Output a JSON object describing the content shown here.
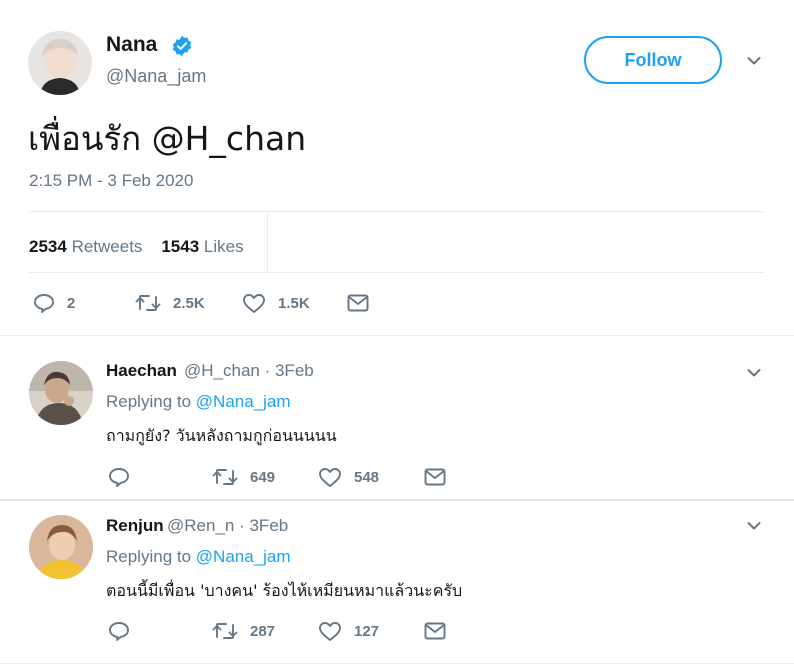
{
  "tweet": {
    "author_name": "Nana",
    "author_handle": "@Nana_jam",
    "follow_label": "Follow",
    "text": "เพื่อนรัก @H_chan",
    "timestamp": "2:15 PM - 3 Feb 2020",
    "retweets_count": "2534",
    "retweets_label": "Retweets",
    "likes_count": "1543",
    "likes_label": "Likes",
    "actions": {
      "replies": "2",
      "retweets": "2.5K",
      "likes": "1.5K"
    }
  },
  "replies": [
    {
      "name": "Haechan",
      "handle": "@H_chan",
      "date": "· 3Feb",
      "replying_label": "Replying to",
      "replying_to": "@Nana_jam",
      "text": "ถามกูยัง? วันหลังถามกูก่อนนนนน",
      "actions": {
        "retweets": "649",
        "likes": "548"
      }
    },
    {
      "name": "Renjun",
      "handle": "@Ren_n",
      "date": "· 3Feb",
      "replying_label": "Replying to",
      "replying_to": "@Nana_jam",
      "text": "ตอนนี้มีเพื่อน 'บางคน' ร้องไห้เหมียนหมาแล้วนะครับ",
      "actions": {
        "retweets": "287",
        "likes": "127"
      }
    }
  ],
  "colors": {
    "accent": "#1da1f2",
    "secondary_text": "#657786",
    "divider": "#e6ecf0",
    "verified": "#1da1f2"
  }
}
